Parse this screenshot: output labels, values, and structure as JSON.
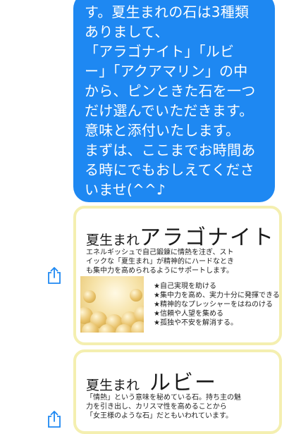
{
  "message": {
    "lines": [
      "す。夏生まれの石は3種類",
      "ありまして、",
      "「アラゴナイト」「ルビ",
      "ー」「アクアマリン」の中",
      "から、ピンときた石を一つ",
      "だけ選んでいただきます。",
      "意味と添付いたします。",
      "まずは、ここまでお時間あ",
      "る時にでもおしえてくださ",
      "いませ(^^♪"
    ]
  },
  "cards": [
    {
      "title_prefix": "夏生まれ",
      "title_main": "アラゴナイト",
      "description": [
        "エネルギッシュで自己鍛錬に情熱を注ぎ、スト",
        "イックな「夏生まれ」が精神的にハードなとき",
        "も集中力を高められるようにサポートします。"
      ],
      "bullets": [
        "★自己実現を助ける",
        "★集中力を高め、実力十分に発揮できる",
        "★精神的なプレッシャーをはねのける",
        "★信頼や人望を集める",
        "★孤独や不安を解消する。"
      ]
    },
    {
      "title_prefix": "夏生まれ",
      "title_main": "ルビー",
      "description": [
        "「情熱」という意味を秘めている石。持ち主の魅",
        "力を引き出し、カリスマ性を高めることから",
        "「女王様のような石」だともいわれています。"
      ]
    }
  ],
  "colors": {
    "bubble": "#1e88f2",
    "share_icon": "#1e88f2",
    "card_border": "#f4efb0"
  },
  "icons": [
    "share-icon"
  ]
}
